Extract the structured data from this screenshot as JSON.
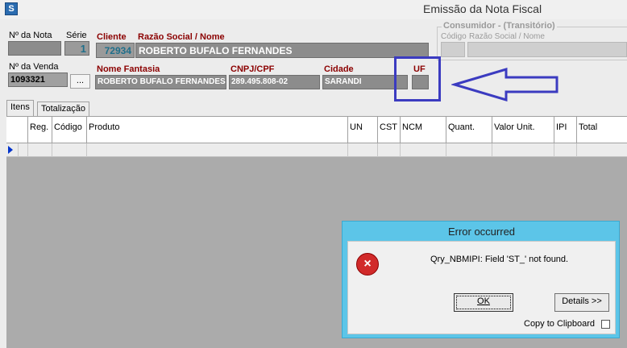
{
  "window": {
    "icon": "app-icon",
    "icon_letter": "S",
    "title": "Emissão da Nota Fiscal"
  },
  "nota": {
    "label_numero": "Nº da Nota",
    "label_serie": "Série",
    "serie_value": "1",
    "label_venda": "Nº da Venda",
    "venda_value": "1093321",
    "lookup_button": "..."
  },
  "cliente": {
    "label_cliente": "Cliente",
    "label_razao": "Razão Social / Nome",
    "codigo": "72934",
    "razao": "ROBERTO BUFALO FERNANDES",
    "label_fantasia": "Nome Fantasia",
    "fantasia": "ROBERTO BUFALO FERNANDES",
    "label_cnpj": "CNPJ/CPF",
    "cnpj": "289.495.808-02",
    "label_cidade": "Cidade",
    "cidade": "SARANDI",
    "label_uf": "UF",
    "uf": ""
  },
  "consumidor": {
    "group_title": "Consumidor - (Transitório)",
    "label_codigo": "Código",
    "label_razao": "Razão Social / Nome"
  },
  "tabs": [
    "Itens",
    "Totalização"
  ],
  "grid": {
    "columns": [
      "",
      "Reg.",
      "Código",
      "Produto",
      "UN",
      "CST",
      "NCM",
      "Quant.",
      "Valor Unit.",
      "IPI",
      "Total"
    ]
  },
  "dialog": {
    "title": "Error occurred",
    "message": "Qry_NBMIPI: Field 'ST_' not found.",
    "ok_label": "OK",
    "details_label": "Details >>",
    "clipboard_label": "Copy to Clipboard",
    "clipboard_checked": false
  },
  "colors": {
    "label_red": "#8b0000",
    "field_grey": "#8c8c8c",
    "annotation_blue": "#3b3bc0",
    "dialog_header": "#5cc5e8",
    "row_indicator": "#0033cc"
  }
}
